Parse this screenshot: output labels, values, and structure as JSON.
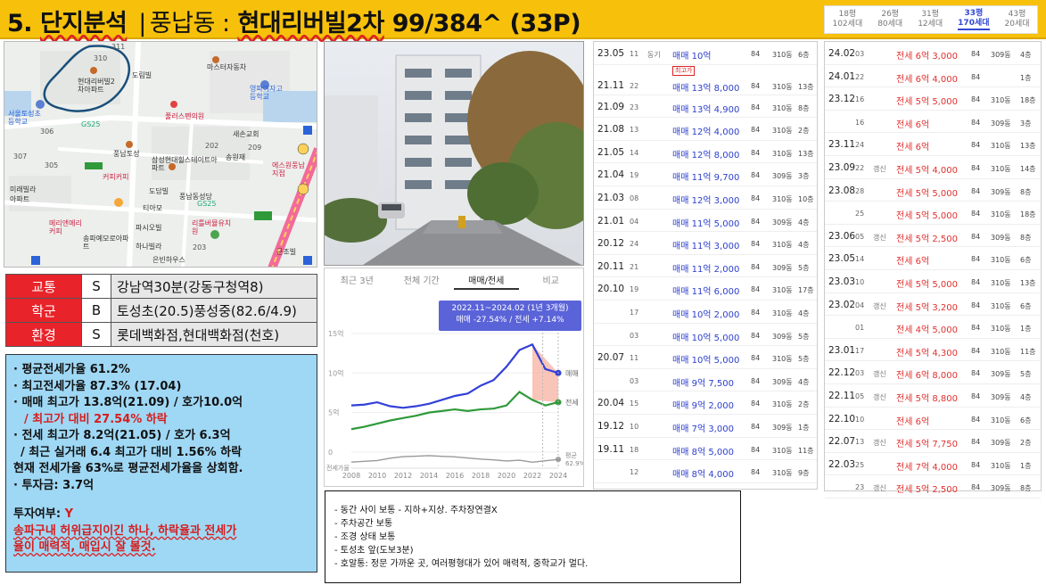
{
  "header": {
    "title_num": "5.",
    "title_word": "단지분석",
    "title_sep": "|",
    "title_loc": "풍납동 :",
    "title_apt": "현대리버빌2차",
    "title_count": "99/384^ (33P)",
    "sizes": [
      {
        "label": "18평",
        "sub": "102세대"
      },
      {
        "label": "26평",
        "sub": "80세대"
      },
      {
        "label": "31평",
        "sub": "12세대"
      },
      {
        "label": "33평",
        "sub": "170세대"
      },
      {
        "label": "43평",
        "sub": "20세대"
      }
    ]
  },
  "map": {
    "labels": [
      "310",
      "311",
      "현대리버빌2차아파트",
      "도림빌",
      "마스터자동차",
      "서울토성초등학교",
      "영파여자고등학교",
      "풀러스펜의원",
      "새손교회",
      "풍납토성",
      "송원재",
      "삼성현대힐스테이트아파트",
      "미래빌라",
      "아파트",
      "커피커피",
      "도담빌",
      "풍납동성당",
      "티아모",
      "GS25",
      "메리앤메리커피",
      "송파예모로아파트",
      "파시오빌",
      "리틀버뮬유치원",
      "하나빌라",
      "은빈하우스",
      "306",
      "307",
      "305",
      "202",
      "209",
      "203",
      "GS25",
      "에스원풍납지점",
      "근조빌"
    ]
  },
  "scores": [
    {
      "cat": "교통",
      "grade": "S",
      "desc": "강남역30분(강동구청역8)"
    },
    {
      "cat": "학군",
      "grade": "B",
      "desc": "토성초(20.5)풍성중(82.6/4.9)"
    },
    {
      "cat": "환경",
      "grade": "S",
      "desc": "롯데백화점,현대백화점(천호)"
    }
  ],
  "summary": {
    "l1": "· 평균전세가율 61.2%",
    "l2": "· 최고전세가율 87.3% (17.04)",
    "l3": "· 매매 최고가 13.8억(21.09) / 호가10.0억",
    "l4": "/ 최고가 대비 27.54% 하락",
    "l5": "· 전세 최고가 8.2억(21.05) / 호가 6.3억",
    "l6": "/ 최근 실거래 6.4 최고가 대비 1.56% 하락",
    "l7": "현재 전세가율 63%로 평균전세가율을 상회함.",
    "l8": "· 투자금: 3.7억",
    "l9_prefix": "투자여부: ",
    "l9_value": "Y",
    "l10": "송파구내 허위급지이긴 하나, 하락율과 전세가",
    "l11": "율이 매력적, 매입시 잘 볼것."
  },
  "chart_tabs": [
    "최근 3년",
    "전체 기간",
    "매매/전세",
    "비교"
  ],
  "chart_tooltip": {
    "line1": "2022.11~2024.02 (1년 3개월)",
    "line2": "매매 -27.54% / 전세 +7.14%"
  },
  "chart_data": {
    "type": "line",
    "x": [
      2008,
      2009,
      2010,
      2011,
      2012,
      2013,
      2014,
      2015,
      2016,
      2017,
      2018,
      2019,
      2020,
      2021,
      2022,
      2023,
      2024
    ],
    "x_ticks": [
      "2008",
      "2010",
      "2012",
      "2014",
      "2016",
      "2018",
      "2020",
      "2022",
      "2024"
    ],
    "y_ticks": [
      "0",
      "5억",
      "10억",
      "15억"
    ],
    "ylim": [
      0,
      16
    ],
    "series": [
      {
        "name": "매매",
        "color": "#3340d8",
        "values": [
          5.9,
          6.0,
          6.3,
          5.8,
          5.6,
          5.8,
          6.1,
          6.6,
          7.1,
          7.4,
          8.4,
          9.1,
          10.8,
          12.9,
          13.6,
          10.5,
          10.0
        ]
      },
      {
        "name": "전세",
        "color": "#2f9a3a",
        "values": [
          2.9,
          3.2,
          3.6,
          4.0,
          4.3,
          4.6,
          5.0,
          5.2,
          5.4,
          5.2,
          5.4,
          5.5,
          5.9,
          7.6,
          6.6,
          5.9,
          6.3
        ]
      }
    ],
    "ratio_label": "전세가율",
    "ratio_end": "평균\n62.9%",
    "grid": true
  },
  "notes": [
    "- 동간 사이 보통 - 지하+지상. 주차장연결X",
    "- 주차공간 보통",
    "- 조경 상태 보통",
    "- 토성초 앞(도보3분)",
    "- 호알통: 정문 가까운 곳, 여러평형대가 있어 매력적, 중학교가 멀다."
  ],
  "trades": [
    {
      "date": "23.05",
      "day": "11",
      "flag": "동기",
      "price": "매매 10억",
      "area": "84",
      "bldg": "310동",
      "floor": "6층"
    },
    {
      "date": "21.11",
      "day": "22",
      "flag": "",
      "price": "매매 13억 8,000",
      "area": "84",
      "bldg": "310동",
      "floor": "13층",
      "badge": "최고가"
    },
    {
      "date": "21.09",
      "day": "23",
      "flag": "",
      "price": "매매 13억 4,900",
      "area": "84",
      "bldg": "310동",
      "floor": "8층"
    },
    {
      "date": "21.08",
      "day": "13",
      "flag": "",
      "price": "매매 12억 4,000",
      "area": "84",
      "bldg": "310동",
      "floor": "2층"
    },
    {
      "date": "21.05",
      "day": "14",
      "flag": "",
      "price": "매매 12억 8,000",
      "area": "84",
      "bldg": "310동",
      "floor": "13층"
    },
    {
      "date": "21.04",
      "day": "19",
      "flag": "",
      "price": "매매 11억 9,700",
      "area": "84",
      "bldg": "309동",
      "floor": "3층"
    },
    {
      "date": "21.03",
      "day": "08",
      "flag": "",
      "price": "매매 12억 3,000",
      "area": "84",
      "bldg": "310동",
      "floor": "10층"
    },
    {
      "date": "21.01",
      "day": "04",
      "flag": "",
      "price": "매매 11억 5,000",
      "area": "84",
      "bldg": "309동",
      "floor": "4층"
    },
    {
      "date": "20.12",
      "day": "24",
      "flag": "",
      "price": "매매 11억 3,000",
      "area": "84",
      "bldg": "310동",
      "floor": "4층"
    },
    {
      "date": "20.11",
      "day": "21",
      "flag": "",
      "price": "매매 11억 2,000",
      "area": "84",
      "bldg": "309동",
      "floor": "5층"
    },
    {
      "date": "20.10",
      "day": "19",
      "flag": "",
      "price": "매매 11억 6,000",
      "area": "84",
      "bldg": "310동",
      "floor": "17층"
    },
    {
      "date": "",
      "day": "17",
      "flag": "",
      "price": "매매 10억 2,000",
      "area": "84",
      "bldg": "310동",
      "floor": "4층"
    },
    {
      "date": "",
      "day": "03",
      "flag": "",
      "price": "매매 10억 5,000",
      "area": "84",
      "bldg": "309동",
      "floor": "5층"
    },
    {
      "date": "20.07",
      "day": "11",
      "flag": "",
      "price": "매매 10억 5,000",
      "area": "84",
      "bldg": "310동",
      "floor": "5층"
    },
    {
      "date": "",
      "day": "03",
      "flag": "",
      "price": "매매 9억 7,500",
      "area": "84",
      "bldg": "309동",
      "floor": "4층"
    },
    {
      "date": "20.04",
      "day": "15",
      "flag": "",
      "price": "매매 9억 2,000",
      "area": "84",
      "bldg": "310동",
      "floor": "2층"
    },
    {
      "date": "19.12",
      "day": "10",
      "flag": "",
      "price": "매매 7억 3,000",
      "area": "84",
      "bldg": "309동",
      "floor": "1층"
    },
    {
      "date": "19.11",
      "day": "18",
      "flag": "",
      "price": "매매 8억 5,000",
      "area": "84",
      "bldg": "310동",
      "floor": "11층"
    },
    {
      "date": "",
      "day": "12",
      "flag": "",
      "price": "매매 8억 4,000",
      "area": "84",
      "bldg": "310동",
      "floor": "9층"
    }
  ],
  "rents": [
    {
      "date": "24.02",
      "day": "03",
      "flag": "",
      "price": "전세 6억 3,000",
      "area": "84",
      "bldg": "309동",
      "floor": "4층"
    },
    {
      "date": "24.01",
      "day": "22",
      "flag": "",
      "price": "전세 6억 4,000",
      "area": "84",
      "bldg": "",
      "floor": "1층"
    },
    {
      "date": "23.12",
      "day": "16",
      "flag": "",
      "price": "전세 5억 5,000",
      "area": "84",
      "bldg": "310동",
      "floor": "18층"
    },
    {
      "date": "",
      "day": "16",
      "flag": "",
      "price": "전세 6억",
      "area": "84",
      "bldg": "309동",
      "floor": "3층"
    },
    {
      "date": "23.11",
      "day": "24",
      "flag": "",
      "price": "전세 6억",
      "area": "84",
      "bldg": "310동",
      "floor": "13층"
    },
    {
      "date": "23.09",
      "day": "22",
      "flag": "갱신",
      "price": "전세 5억 4,000",
      "area": "84",
      "bldg": "310동",
      "floor": "14층"
    },
    {
      "date": "23.08",
      "day": "28",
      "flag": "",
      "price": "전세 5억 5,000",
      "area": "84",
      "bldg": "309동",
      "floor": "8층"
    },
    {
      "date": "",
      "day": "25",
      "flag": "",
      "price": "전세 5억 5,000",
      "area": "84",
      "bldg": "310동",
      "floor": "18층"
    },
    {
      "date": "23.06",
      "day": "05",
      "flag": "갱신",
      "price": "전세 5억 2,500",
      "area": "84",
      "bldg": "309동",
      "floor": "8층"
    },
    {
      "date": "23.05",
      "day": "14",
      "flag": "",
      "price": "전세 6억",
      "area": "84",
      "bldg": "310동",
      "floor": "6층"
    },
    {
      "date": "23.03",
      "day": "10",
      "flag": "",
      "price": "전세 5억 5,000",
      "area": "84",
      "bldg": "310동",
      "floor": "13층"
    },
    {
      "date": "23.02",
      "day": "04",
      "flag": "갱신",
      "price": "전세 5억 3,200",
      "area": "84",
      "bldg": "310동",
      "floor": "6층"
    },
    {
      "date": "",
      "day": "01",
      "flag": "",
      "price": "전세 4억 5,000",
      "area": "84",
      "bldg": "310동",
      "floor": "1층"
    },
    {
      "date": "23.01",
      "day": "17",
      "flag": "",
      "price": "전세 5억 4,300",
      "area": "84",
      "bldg": "310동",
      "floor": "11층"
    },
    {
      "date": "22.12",
      "day": "03",
      "flag": "갱신",
      "price": "전세 6억 8,000",
      "area": "84",
      "bldg": "309동",
      "floor": "5층"
    },
    {
      "date": "22.11",
      "day": "05",
      "flag": "갱신",
      "price": "전세 5억 8,800",
      "area": "84",
      "bldg": "309동",
      "floor": "4층"
    },
    {
      "date": "22.10",
      "day": "10",
      "flag": "",
      "price": "전세 6억",
      "area": "84",
      "bldg": "310동",
      "floor": "6층"
    },
    {
      "date": "22.07",
      "day": "13",
      "flag": "갱신",
      "price": "전세 5억 7,750",
      "area": "84",
      "bldg": "309동",
      "floor": "2층"
    },
    {
      "date": "22.03",
      "day": "25",
      "flag": "",
      "price": "전세 7억 4,000",
      "area": "84",
      "bldg": "310동",
      "floor": "1층"
    },
    {
      "date": "",
      "day": "23",
      "flag": "갱신",
      "price": "전세 5억 2,500",
      "area": "84",
      "bldg": "309동",
      "floor": "8층"
    }
  ]
}
